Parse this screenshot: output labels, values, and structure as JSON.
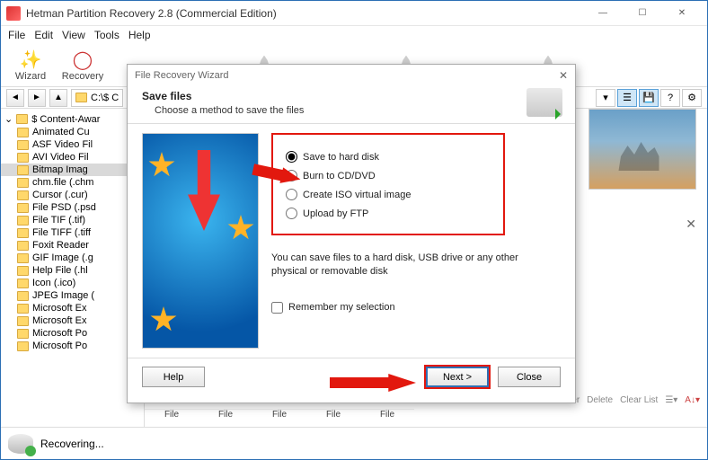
{
  "window": {
    "title": "Hetman Partition Recovery 2.8 (Commercial Edition)"
  },
  "menu": [
    "File",
    "Edit",
    "View",
    "Tools",
    "Help"
  ],
  "toolbar": {
    "wizard": "Wizard",
    "recovery": "Recovery"
  },
  "address": {
    "path": "C:\\$ C"
  },
  "tree": {
    "root": "$ Content-Awar",
    "items": [
      "Animated Cu",
      "ASF Video Fil",
      "AVI Video Fil",
      "Bitmap Imag",
      "chm.file (.chm",
      "Cursor (.cur)",
      "File PSD (.psd",
      "File TIF (.tif)",
      "File TIFF (.tiff",
      "Foxit Reader",
      "GIF Image (.g",
      "Help File (.hl",
      "Icon (.ico)",
      "JPEG Image (",
      "Microsoft Ex",
      "Microsoft Ex",
      "Microsoft Po",
      "Microsoft Po"
    ],
    "selected_index": 3
  },
  "filebar": [
    "File",
    "File",
    "File",
    "File",
    "File"
  ],
  "meta": {
    "recover": "Recover",
    "delete": "Delete",
    "clear": "Clear List"
  },
  "status": {
    "text": "Recovering..."
  },
  "dialog": {
    "title": "File Recovery Wizard",
    "heading": "Save files",
    "sub": "Choose a method to save the files",
    "options": [
      "Save to hard disk",
      "Burn to CD/DVD",
      "Create ISO virtual image",
      "Upload by FTP"
    ],
    "hint": "You can save files to a hard disk, USB drive or any other physical or removable disk",
    "remember": "Remember my selection",
    "buttons": {
      "help": "Help",
      "next": "Next >",
      "close": "Close"
    }
  }
}
